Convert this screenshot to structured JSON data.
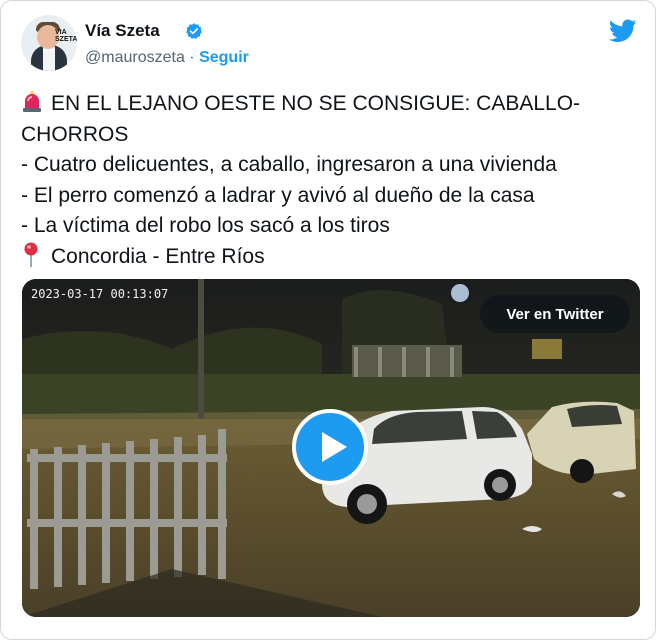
{
  "account": {
    "name": "Vía Szeta",
    "handle": "@mauroszeta",
    "separator": "·",
    "follow_label": "Seguir",
    "avatar_logo_line1": "VIA",
    "avatar_logo_line2": "SZETA"
  },
  "tweet": {
    "lines": [
      "EN EL LEJANO OESTE NO SE CONSIGUE: CABALLO-",
      "CHORROS",
      "- Cuatro delicuentes, a caballo, ingresaron a una vivienda",
      "- El perro comenzó a ladrar y avivó al dueño de la casa",
      "- La víctima del robo los sacó a los tiros",
      "Concordia - Entre Ríos"
    ]
  },
  "media": {
    "timestamp": "2023-03-17 00:13:07",
    "watch_label": "Ver en Twitter"
  },
  "colors": {
    "accent": "#1d9bf0",
    "text": "#0f1419",
    "muted": "#536471",
    "siren": "#e0245e"
  },
  "icons": [
    "verified-badge-icon",
    "twitter-bird-icon",
    "siren-emoji-icon",
    "pin-emoji-icon",
    "play-icon"
  ]
}
